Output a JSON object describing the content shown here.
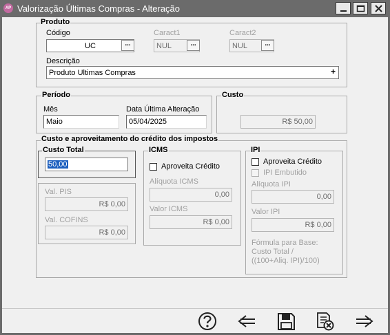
{
  "window": {
    "title": "Valorização Últimas Compras - Alteração",
    "app_icon_text": "AP",
    "buttons": [
      "minimize-icon",
      "maximize-icon",
      "close-icon"
    ]
  },
  "produto": {
    "title": "Produto",
    "codigo_label": "Código",
    "codigo_value": "UC",
    "caract1_label": "Caract1",
    "caract1_value": "NUL",
    "caract2_label": "Caract2",
    "caract2_value": "NUL",
    "descricao_label": "Descrição",
    "descricao_value": "Produto Ultimas Compras",
    "lookup_glyph": "...",
    "plus_glyph": "+"
  },
  "periodo": {
    "title": "Período",
    "mes_label": "Mês",
    "mes_value": "Maio",
    "data_label": "Data Última Alteração",
    "data_value": "05/04/2025"
  },
  "custo": {
    "title": "Custo",
    "value": "R$ 50,00"
  },
  "impostos": {
    "title": "Custo e aproveitamento do crédito dos impostos",
    "custo_total_title": "Custo Total",
    "custo_total_value": "50,00",
    "pis_label": "Val. PIS",
    "pis_value": "R$ 0,00",
    "cofins_label": "Val. COFINS",
    "cofins_value": "R$ 0,00",
    "icms": {
      "title": "ICMS",
      "aproveita_label": "Aproveita Crédito",
      "aproveita_checked": false,
      "aliquota_label": "Alíquota ICMS",
      "aliquota_value": "0,00",
      "valor_label": "Valor ICMS",
      "valor_value": "R$ 0,00"
    },
    "ipi": {
      "title": "IPI",
      "aproveita_label": "Aproveita Crédito",
      "aproveita_checked": false,
      "embutido_label": "IPI Embutido",
      "embutido_checked": false,
      "aliquota_label": "Alíquota IPI",
      "aliquota_value": "0,00",
      "valor_label": "Valor IPI",
      "valor_value": "R$ 0,00",
      "formula_line1": "Fórmula para Base:",
      "formula_line2": "Custo Total /",
      "formula_line3": "((100+Aliq. IPI)/100)"
    }
  },
  "footer": {
    "buttons": [
      "help-icon",
      "back-arrow-icon",
      "save-icon",
      "cancel-document-icon",
      "forward-arrow-icon"
    ]
  }
}
